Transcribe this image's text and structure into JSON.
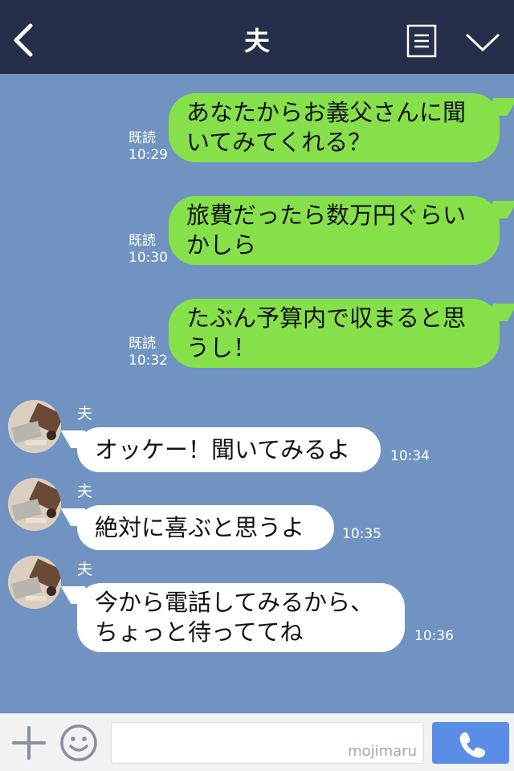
{
  "header": {
    "title": "夫"
  },
  "messages_out": [
    {
      "text": "あなたからお義父さんに聞いてみてくれる？",
      "read": "既読",
      "time": "10:29"
    },
    {
      "text": "旅費だったら数万円ぐらいかしら",
      "read": "既読",
      "time": "10:30"
    },
    {
      "text": "たぶん予算内で収まると思うし！",
      "read": "既読",
      "time": "10:32"
    }
  ],
  "messages_in": [
    {
      "sender": "夫",
      "text": "オッケー！聞いてみるよ",
      "time": "10:34"
    },
    {
      "sender": "夫",
      "text": "絶対に喜ぶと思うよ",
      "time": "10:35"
    },
    {
      "sender": "夫",
      "text": "今から電話してみるから、ちょっと待っててね",
      "time": "10:36"
    }
  ],
  "footer": {
    "watermark": "mojimaru"
  },
  "colors": {
    "header": "#252f49",
    "background": "#7193c1",
    "outgoing": "#86e04a",
    "incoming": "#ffffff",
    "call": "#5a8ee6"
  }
}
